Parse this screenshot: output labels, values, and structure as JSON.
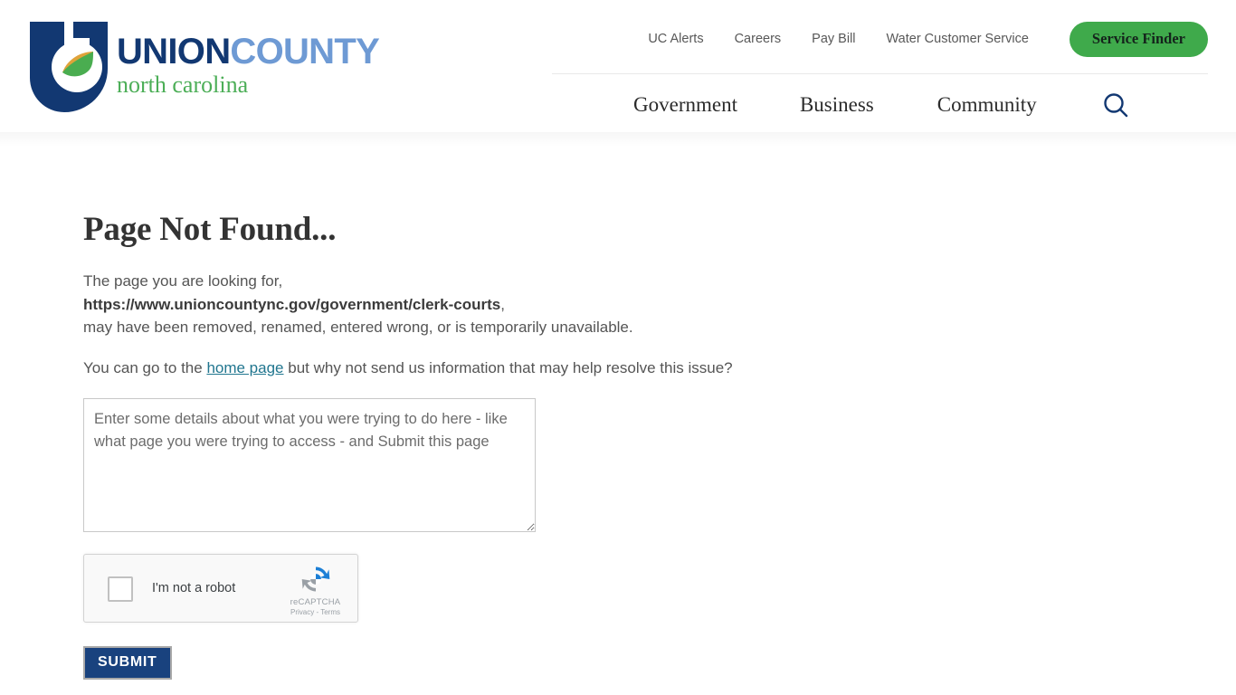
{
  "header": {
    "logo": {
      "mark_name": "union-county-c-leaf-logo",
      "word_union": "UNION",
      "word_county": "COUNTY",
      "tagline": "north carolina",
      "colors": {
        "navy": "#123872",
        "light_blue": "#6e9ad4",
        "green": "#4cae57",
        "leaf_gold": "#e0a33a",
        "leaf_green": "#4aad50"
      }
    },
    "utility_links": [
      {
        "label": "UC Alerts"
      },
      {
        "label": "Careers"
      },
      {
        "label": "Pay Bill"
      },
      {
        "label": "Water Customer Service"
      }
    ],
    "service_finder_label": "Service Finder",
    "service_finder_color": "#3faa4b",
    "nav_items": [
      {
        "label": "Government"
      },
      {
        "label": "Business"
      },
      {
        "label": "Community"
      }
    ],
    "search_icon": "search-icon",
    "search_icon_color": "#123872"
  },
  "main": {
    "title": "Page Not Found...",
    "intro_line1": "The page you are looking for,",
    "requested_url": "https://www.unioncountync.gov/government/clerk-courts",
    "intro_comma": ",",
    "intro_line3": "may have been removed, renamed, entered wrong, or is temporarily unavailable.",
    "help_prefix": "You can go to the ",
    "home_link_label": "home page",
    "home_link_color": "#21768f",
    "help_suffix": " but why not send us information that may help resolve this issue?",
    "details_placeholder": "Enter some details about what you were trying to do here - like what page you were trying to access - and Submit this page",
    "details_value": "",
    "recaptcha": {
      "checkbox_label": "I'm not a robot",
      "brand_name": "reCAPTCHA",
      "privacy_label": "Privacy",
      "separator": " - ",
      "terms_label": "Terms"
    },
    "submit_label": "SUBMIT",
    "submit_color": "#19427e"
  }
}
